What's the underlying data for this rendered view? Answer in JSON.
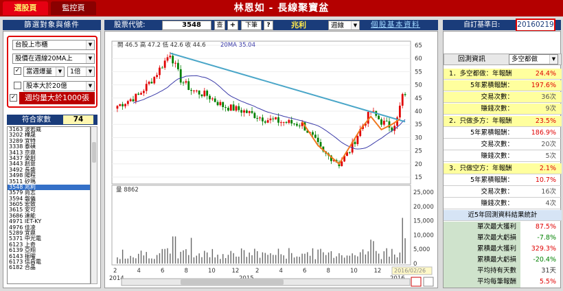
{
  "top": {
    "tab_pick": "選股頁",
    "tab_monitor": "監控頁",
    "title": "林恩如 - 長線聚寶盆"
  },
  "bar": {
    "filter_title": "篩選對象與條件",
    "stock_code_label": "股票代號:",
    "stock_code_value": "3548",
    "query_btn": "查",
    "plus_btn": "+",
    "next_btn": "下筆",
    "help_btn": "?",
    "stock_name": "兆利",
    "period_select": "週線",
    "basic_info_link": "個股基本資料",
    "base_date_label": "自訂基準日:",
    "base_date_value": "20160219"
  },
  "filters": {
    "market": "台股上市櫃",
    "condition": "股價在週線20MA上",
    "vol_label": "當週爆量",
    "vol_mult": "1倍",
    "capital": "股本大於20億",
    "weekly_vol": "週均量大於1000張"
  },
  "count": {
    "label": "符合家數",
    "value": "74"
  },
  "stock_list": [
    "3163 波若威",
    "3202 樺晟",
    "3289 宜特",
    "3338 泰碩",
    "3413 京鼎",
    "3437 榮創",
    "3443 創意",
    "3492 長盛",
    "3498 陽程",
    "3511 矽瑪",
    "3548 兆利",
    "3579 尚志",
    "3594 磐儀",
    "3605 宏致",
    "3615 安可",
    "3686 達能",
    "4971 IET-KY",
    "4976 佳凌",
    "5289 宜鼎",
    "5371 中光電",
    "6123 上奇",
    "6139 亞翔",
    "6143 振曜",
    "6173 信昌電",
    "6182 合晶"
  ],
  "selected_stock": "3548 兆利",
  "chart": {
    "ohlc_label": "開 46.5  高 47.2  低 42.6  收 44.6",
    "ma_label": "20MA 35.04",
    "volume_label": "量 8862",
    "date_tag": "2016/02/26",
    "x_ticks": [
      "2",
      "4",
      "6",
      "8",
      "10",
      "12",
      "2",
      "4",
      "6",
      "8",
      "10",
      "12",
      "2"
    ],
    "year_ticks": [
      "2014",
      "2015",
      "2016"
    ],
    "price_ticks": [
      "65",
      "60",
      "55",
      "50",
      "45",
      "40",
      "35",
      "30",
      "25",
      "20",
      "15"
    ],
    "volume_ticks": [
      "25,000",
      "20,000",
      "15,000",
      "10,000",
      "5,000",
      "0"
    ],
    "colors": {
      "up": "#e00000",
      "down": "#008000",
      "ma": "#3a3aa8",
      "trend": "#4aa6c8",
      "pattern": "#f07820"
    }
  },
  "right": {
    "header": "回測資訊",
    "mode_select": "多空都做",
    "sections": [
      {
        "title": "1．多空都做：年報酬",
        "title_value": "24.4%",
        "rows": [
          {
            "label": "5年累積報酬：",
            "value": "197.6%"
          },
          {
            "label": "交易次數：",
            "value": "36次"
          },
          {
            "label": "賺錢次數：",
            "value": "9次"
          }
        ]
      },
      {
        "title": "2．只做多方：年報酬",
        "title_value": "23.5%",
        "rows": [
          {
            "label": "5年累積報酬：",
            "value": "186.9%"
          },
          {
            "label": "交易次數：",
            "value": "20次"
          },
          {
            "label": "賺錢次數：",
            "value": "5次"
          }
        ]
      },
      {
        "title": "3．只做空方：年報酬",
        "title_value": "2.1%",
        "rows": [
          {
            "label": "5年累積報酬：",
            "value": "10.7%"
          },
          {
            "label": "交易次數：",
            "value": "16次"
          },
          {
            "label": "賺錢次數：",
            "value": "4次"
          }
        ]
      }
    ],
    "stats_title": "近5年回測資料結果統計",
    "stats": [
      {
        "label": "單次最大獲利",
        "value": "87.5%"
      },
      {
        "label": "單次最大虧損",
        "value": "-7.8%"
      },
      {
        "label": "累積最大獲利",
        "value": "329.3%"
      },
      {
        "label": "累積最大虧損",
        "value": "-20.4%"
      },
      {
        "label": "平均持有天數",
        "value": "31天"
      },
      {
        "label": "平均每筆報酬",
        "value": "5.5%"
      }
    ]
  }
}
